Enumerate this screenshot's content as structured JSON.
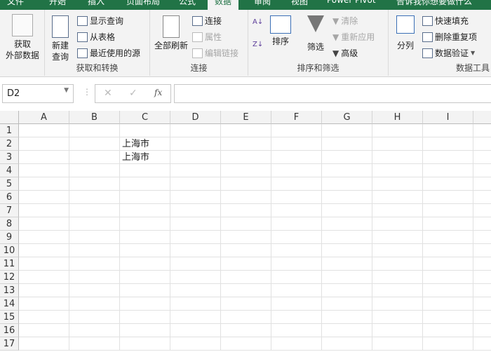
{
  "tabs": [
    "文件",
    "开始",
    "插入",
    "页面布局",
    "公式",
    "数据",
    "审阅",
    "视图",
    "Power Pivot",
    "告诉我你想要做什么"
  ],
  "active_tab": "数据",
  "ribbon": {
    "get_external": "获取\n外部数据",
    "get_external_l1": "获取",
    "get_external_l2": "外部数据",
    "new_query_l1": "新建",
    "new_query_l2": "查询",
    "show_queries": "显示查询",
    "from_table": "从表格",
    "recent_sources": "最近使用的源",
    "group_get_transform": "获取和转换",
    "refresh_all": "全部刷新",
    "connections": "连接",
    "properties": "属性",
    "edit_links": "编辑链接",
    "group_connections": "连接",
    "sort": "排序",
    "filter": "筛选",
    "clear": "清除",
    "reapply": "重新应用",
    "advanced": "高级",
    "group_sort_filter": "排序和筛选",
    "text_to_columns": "分列",
    "flash_fill": "快速填充",
    "remove_duplicates": "删除重复项",
    "data_validation": "数据验证",
    "group_data_tools": "数据工具"
  },
  "formula_bar": {
    "name_box": "D2",
    "fx": "fx",
    "value": ""
  },
  "columns": [
    "A",
    "B",
    "C",
    "D",
    "E",
    "F",
    "G",
    "H",
    "I"
  ],
  "rows": [
    "1",
    "2",
    "3",
    "4",
    "5",
    "6",
    "7",
    "8",
    "9",
    "10",
    "11",
    "12",
    "13",
    "14",
    "15",
    "16",
    "17"
  ],
  "cells": {
    "C2": "上海市",
    "C3": "上海市"
  }
}
